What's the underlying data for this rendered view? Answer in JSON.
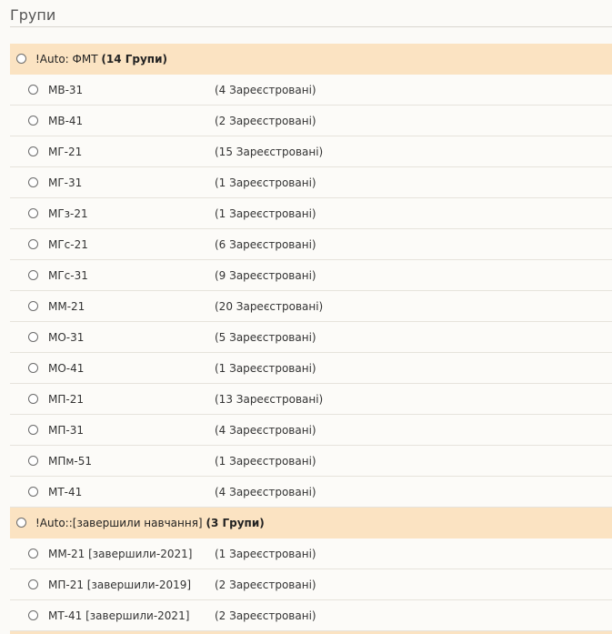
{
  "page": {
    "title": "Групи"
  },
  "groups": [
    {
      "name": "!Auto: ФМТ",
      "count": "(14 Групи)",
      "items": [
        {
          "name": "МВ-31",
          "count": "(4 Зареєстровані)"
        },
        {
          "name": "МВ-41",
          "count": "(2 Зареєстровані)"
        },
        {
          "name": "МГ-21",
          "count": "(15 Зареєстровані)"
        },
        {
          "name": "МГ-31",
          "count": "(1 Зареєстровані)"
        },
        {
          "name": "МГз-21",
          "count": "(1 Зареєстровані)"
        },
        {
          "name": "МГс-21",
          "count": "(6 Зареєстровані)"
        },
        {
          "name": "МГс-31",
          "count": "(9 Зареєстровані)"
        },
        {
          "name": "ММ-21",
          "count": "(20 Зареєстровані)"
        },
        {
          "name": "МО-31",
          "count": "(5 Зареєстровані)"
        },
        {
          "name": "МО-41",
          "count": "(1 Зареєстровані)"
        },
        {
          "name": "МП-21",
          "count": "(13 Зареєстровані)"
        },
        {
          "name": "МП-31",
          "count": "(4 Зареєстровані)"
        },
        {
          "name": "МПм-51",
          "count": "(1 Зареєстровані)"
        },
        {
          "name": "МТ-41",
          "count": "(4 Зареєстровані)"
        }
      ]
    },
    {
      "name": "!Auto::[завершили навчання]",
      "count": "(3 Групи)",
      "items": [
        {
          "name": "ММ-21 [завершили-2021]",
          "count": "(1 Зареєстровані)"
        },
        {
          "name": "МП-21 [завершили-2019]",
          "count": "(2 Зареєстровані)"
        },
        {
          "name": "МТ-41 [завершили-2021]",
          "count": "(2 Зареєстровані)"
        }
      ]
    }
  ]
}
